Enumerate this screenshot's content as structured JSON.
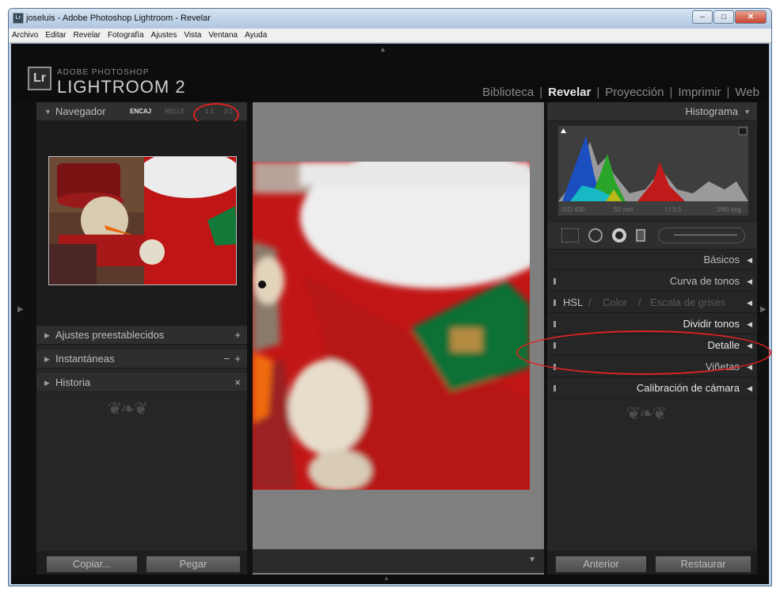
{
  "window": {
    "title": "joseluis - Adobe Photoshop Lightroom - Revelar",
    "icon": "lightroom-app-icon"
  },
  "menu": [
    "Archivo",
    "Editar",
    "Revelar",
    "Fotografía",
    "Ajustes",
    "Vista",
    "Ventana",
    "Ayuda"
  ],
  "brand": {
    "badge": "Lr",
    "line1": "ADOBE PHOTOSHOP",
    "line2": "LIGHTROOM 2"
  },
  "modules": [
    "Biblioteca",
    "Revelar",
    "Proyección",
    "Imprimir",
    "Web"
  ],
  "active_module": "Revelar",
  "left_panel": {
    "navigator": {
      "title": "Navegador",
      "zoom_fit": "ENCAJ",
      "zoom_fill": "RELLE",
      "zoom_1": "1:1",
      "zoom_3": "3:1"
    },
    "presets": {
      "title": "Ajustes preestablecidos",
      "action": "+"
    },
    "snapshots": {
      "title": "Instantáneas",
      "minus": "−",
      "plus": "+"
    },
    "history": {
      "title": "Historia",
      "close": "×"
    },
    "copy_button": "Copiar...",
    "paste_button": "Pegar"
  },
  "right_panel": {
    "histogram": {
      "title": "Histograma",
      "iso": "ISO 400",
      "focal": "50 mm",
      "aperture": "f / 3,5",
      "shutter": "1/60 seg"
    },
    "sections": {
      "basic": "Básicos",
      "tone_curve": "Curva de tonos",
      "hsl": "HSL",
      "color": "Color",
      "grayscale": "Escala de grises",
      "slash": "/",
      "split_toning": "Dividir tonos",
      "detail": "Detalle",
      "vignettes": "Viñetas",
      "calibration": "Calibración de cámara"
    },
    "previous_button": "Anterior",
    "reset_button": "Restaurar"
  },
  "colors": {
    "accent_red": "#d22222",
    "panel": "#262626",
    "background": "#101010"
  }
}
